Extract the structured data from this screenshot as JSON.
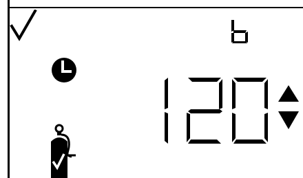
{
  "display": {
    "status_icon": "check-icon",
    "mode_char": "b",
    "timer_icon": "clock-icon",
    "value": "120",
    "adjust_up": "arrow-up-icon",
    "adjust_down": "arrow-down-icon",
    "tank_icon": "tank-check-icon",
    "colors": {
      "segment": "#000000",
      "background": "#ffffff"
    }
  }
}
